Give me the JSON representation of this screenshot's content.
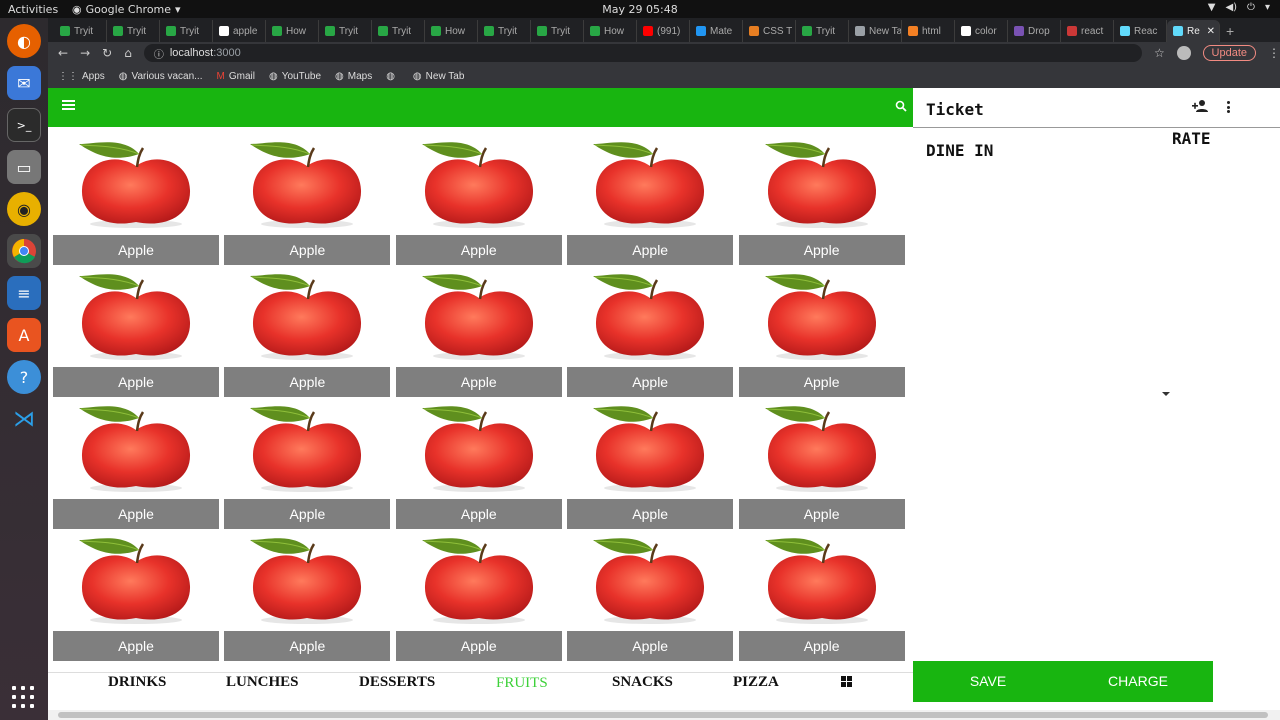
{
  "os": {
    "activities": "Activities",
    "app_name": "Google Chrome",
    "clock": "May 29  05:48"
  },
  "browser": {
    "tabs": [
      {
        "label": "Tryit",
        "color": "#28a745"
      },
      {
        "label": "Tryit",
        "color": "#28a745"
      },
      {
        "label": "Tryit",
        "color": "#28a745"
      },
      {
        "label": "apple",
        "color": "#ffffff"
      },
      {
        "label": "How",
        "color": "#28a745"
      },
      {
        "label": "Tryit",
        "color": "#28a745"
      },
      {
        "label": "Tryit",
        "color": "#28a745"
      },
      {
        "label": "How",
        "color": "#28a745"
      },
      {
        "label": "Tryit",
        "color": "#28a745"
      },
      {
        "label": "Tryit",
        "color": "#28a745"
      },
      {
        "label": "How",
        "color": "#28a745"
      },
      {
        "label": "(991)",
        "color": "#ff0000"
      },
      {
        "label": "Mate",
        "color": "#2196f3"
      },
      {
        "label": "CSS T",
        "color": "#e67e22"
      },
      {
        "label": "Tryit",
        "color": "#28a745"
      },
      {
        "label": "New Tab",
        "color": "#9aa0a6"
      },
      {
        "label": "html",
        "color": "#f48024"
      },
      {
        "label": "color",
        "color": "#ffffff"
      },
      {
        "label": "Drop",
        "color": "#7952b3"
      },
      {
        "label": "react",
        "color": "#cb3837"
      },
      {
        "label": "Reac",
        "color": "#61dafb"
      },
      {
        "label": "Re",
        "color": "#61dafb",
        "active": true
      }
    ],
    "url_host": "localhost",
    "url_port": ":3000",
    "update_label": "Update",
    "bookmarks": [
      "Apps",
      "Various vacan...",
      "Gmail",
      "YouTube",
      "Maps",
      "",
      "New Tab"
    ]
  },
  "products": {
    "items": [
      "Apple",
      "Apple",
      "Apple",
      "Apple",
      "Apple",
      "Apple",
      "Apple",
      "Apple",
      "Apple",
      "Apple",
      "Apple",
      "Apple",
      "Apple",
      "Apple",
      "Apple",
      "Apple",
      "Apple",
      "Apple",
      "Apple",
      "Apple"
    ]
  },
  "categories": {
    "items": [
      {
        "label": "DRINKS",
        "active": false
      },
      {
        "label": "LUNCHES",
        "active": false
      },
      {
        "label": "DESSERTS",
        "active": false
      },
      {
        "label": "FRUITS",
        "active": true
      },
      {
        "label": "SNACKS",
        "active": false
      },
      {
        "label": "PIZZA",
        "active": false
      }
    ]
  },
  "ticket": {
    "title": "Ticket",
    "rate_label": "RATE",
    "order_type": "DINE IN",
    "save_label": "SAVE",
    "charge_label": "CHARGE"
  },
  "colors": {
    "accent_green": "#18b510",
    "active_category": "#3ed13a",
    "label_gray": "#7f7f7f"
  }
}
